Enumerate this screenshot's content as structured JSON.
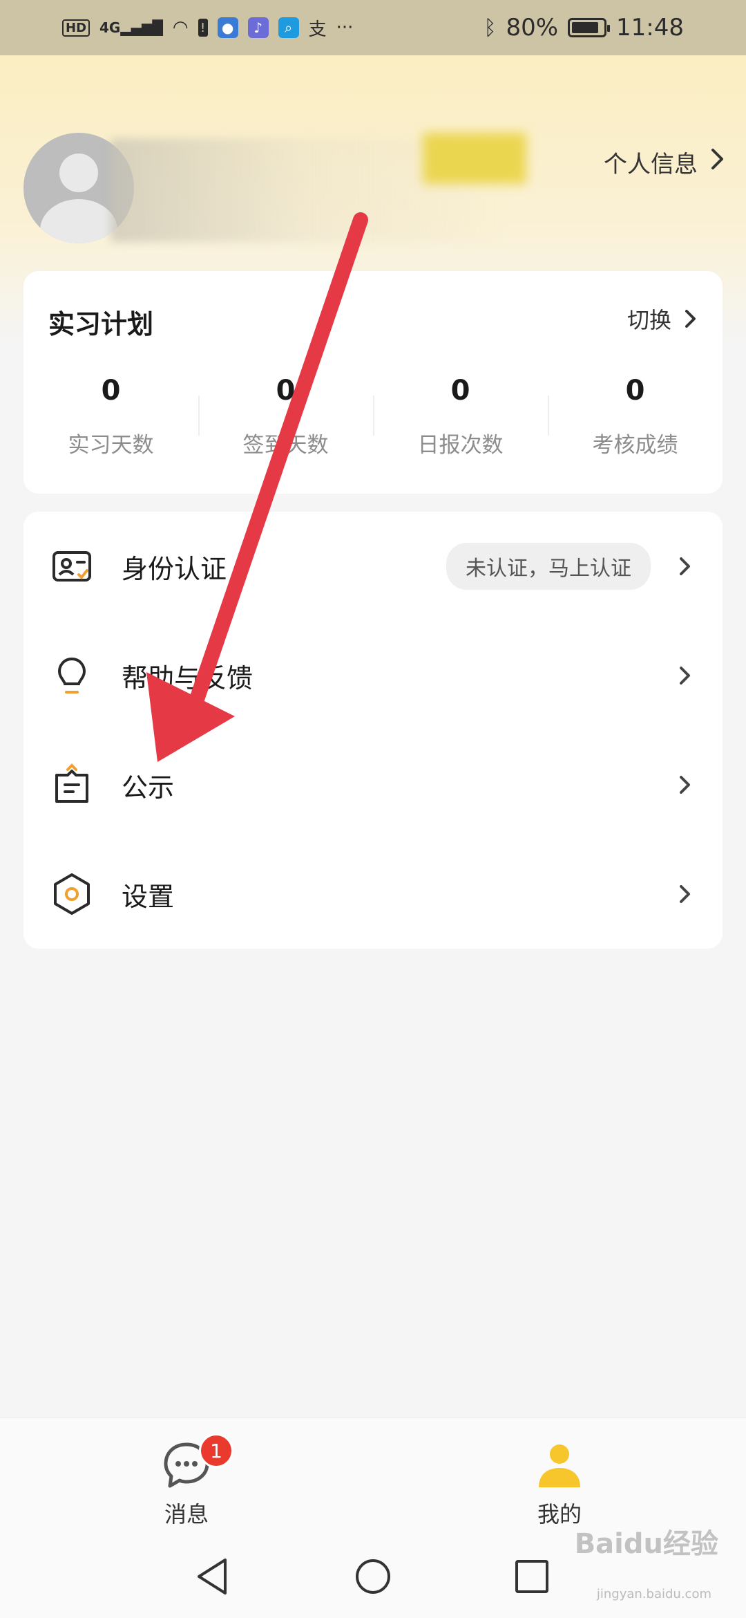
{
  "status_bar": {
    "left_labels": [
      "HD",
      "4G"
    ],
    "battery_percent": "80%",
    "time": "11:48",
    "more": "···"
  },
  "profile": {
    "info_link": "个人信息"
  },
  "plan": {
    "title": "实习计划",
    "switch_label": "切换",
    "stats": [
      {
        "value": "0",
        "label": "实习天数"
      },
      {
        "value": "0",
        "label": "签到天数"
      },
      {
        "value": "0",
        "label": "日报次数"
      },
      {
        "value": "0",
        "label": "考核成绩"
      }
    ]
  },
  "menu": {
    "items": [
      {
        "label": "身份认证",
        "icon": "id-card-icon",
        "badge": "未认证，马上认证"
      },
      {
        "label": "帮助与反馈",
        "icon": "lightbulb-icon"
      },
      {
        "label": "公示",
        "icon": "notice-board-icon"
      },
      {
        "label": "设置",
        "icon": "hexagon-gear-icon"
      }
    ]
  },
  "tabs": [
    {
      "label": "消息",
      "icon": "chat-bubble-icon",
      "badge": "1"
    },
    {
      "label": "我的",
      "icon": "user-icon"
    }
  ],
  "colors": {
    "accent": "#f0a030",
    "active_tab": "#f7c52c",
    "badge": "#ea3a2e",
    "arrow": "#e53946"
  },
  "watermark": {
    "main": "Baidu经验",
    "sub": "jingyan.baidu.com"
  }
}
